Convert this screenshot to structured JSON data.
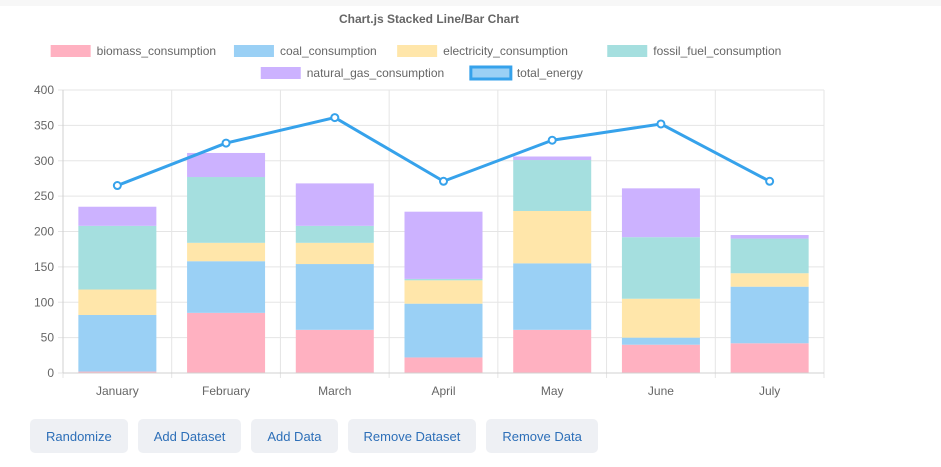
{
  "chart_data": {
    "type": "bar",
    "title": "Chart.js Stacked Line/Bar Chart",
    "categories": [
      "January",
      "February",
      "March",
      "April",
      "May",
      "June",
      "July"
    ],
    "ylim": [
      0,
      400
    ],
    "yticks": [
      0,
      50,
      100,
      150,
      200,
      250,
      300,
      350,
      400
    ],
    "stacked": true,
    "grid": true,
    "legend_position": "top",
    "series": [
      {
        "name": "biomass_consumption",
        "type": "bar",
        "color": "#ffb1c1",
        "values": [
          2,
          85,
          61,
          22,
          61,
          40,
          42
        ]
      },
      {
        "name": "coal_consumption",
        "type": "bar",
        "color": "#9ad0f5",
        "values": [
          80,
          73,
          93,
          76,
          94,
          10,
          80
        ]
      },
      {
        "name": "electricity_consumption",
        "type": "bar",
        "color": "#ffe6aa",
        "values": [
          36,
          26,
          30,
          33,
          74,
          55,
          19
        ]
      },
      {
        "name": "fossil_fuel_consumption",
        "type": "bar",
        "color": "#a5dfdf",
        "values": [
          90,
          93,
          24,
          2,
          72,
          87,
          49
        ]
      },
      {
        "name": "natural_gas_consumption",
        "type": "bar",
        "color": "#ccb2ff",
        "values": [
          27,
          34,
          60,
          95,
          5,
          69,
          5
        ]
      },
      {
        "name": "total_energy",
        "type": "line",
        "color": "#36a2eb",
        "values": [
          265,
          325,
          361,
          271,
          329,
          352,
          271
        ]
      }
    ]
  },
  "buttons": {
    "randomize": "Randomize",
    "add_dataset": "Add Dataset",
    "add_data": "Add Data",
    "remove_dataset": "Remove Dataset",
    "remove_data": "Remove Data"
  }
}
